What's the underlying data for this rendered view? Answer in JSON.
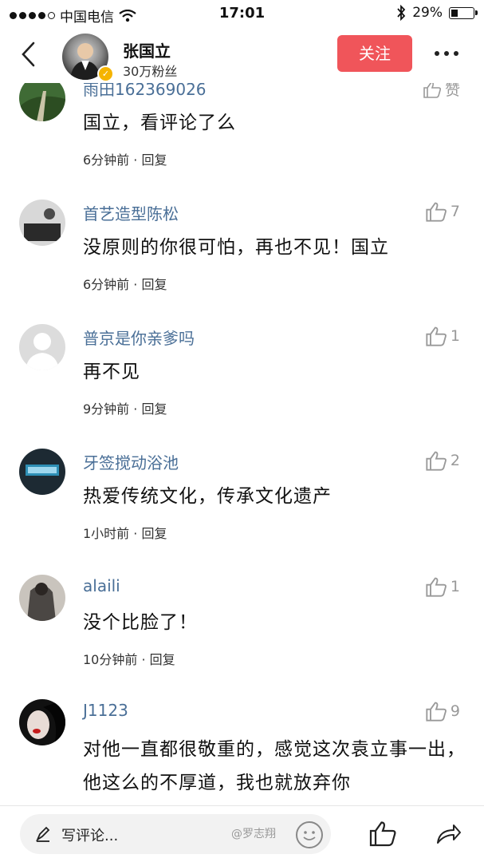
{
  "status_bar": {
    "carrier": "中国电信",
    "time": "17:01",
    "battery": "29%",
    "battery_level": 0.29
  },
  "header": {
    "name": "张国立",
    "fans": "30万粉丝",
    "follow_label": "关注"
  },
  "comments": [
    {
      "name": "雨田162369026",
      "likes": "赞",
      "text": "国立，看评论了么",
      "meta": "6分钟前 · 回复"
    },
    {
      "name": "首艺造型陈松",
      "likes": "7",
      "text": "没原则的你很可怕，再也不见！国立",
      "meta": "6分钟前 · 回复"
    },
    {
      "name": "普京是你亲爹吗",
      "likes": "1",
      "text": "再不见",
      "meta": "9分钟前 · 回复"
    },
    {
      "name": "牙签搅动浴池",
      "likes": "2",
      "text": "热爱传统文化，传承文化遗产",
      "meta": "1小时前 · 回复"
    },
    {
      "name": "alaili",
      "likes": "1",
      "text": "没个比脸了！",
      "meta": "10分钟前 · 回复"
    },
    {
      "name": "J1123",
      "likes": "9",
      "text": "对他一直都很敬重的，感觉这次袁立事一出，他这么的不厚道，我也就放弃你",
      "meta": ""
    }
  ],
  "bottom_bar": {
    "input_placeholder": "写评论...",
    "watermark": "@罗志翔"
  }
}
